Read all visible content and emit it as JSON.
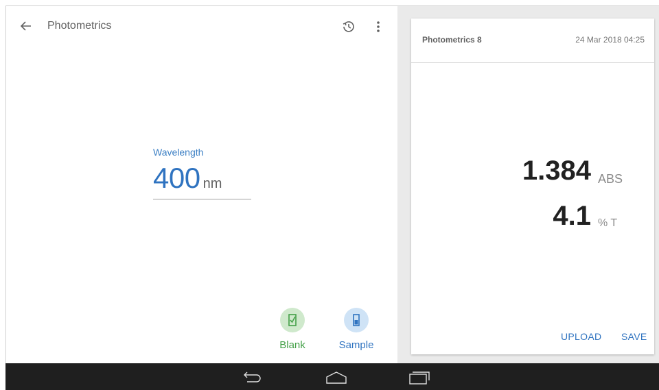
{
  "header": {
    "title": "Photometrics",
    "back_icon": "arrow-left-icon",
    "history_icon": "history-icon",
    "more_icon": "more-vert-icon"
  },
  "wavelength": {
    "label": "Wavelength",
    "value": "400",
    "unit": "nm"
  },
  "actions": {
    "blank": {
      "label": "Blank",
      "icon": "blank-cuvette-icon",
      "color": "#43a047"
    },
    "sample": {
      "label": "Sample",
      "icon": "sample-cuvette-icon",
      "color": "#2f73c0"
    }
  },
  "result_card": {
    "title": "Photometrics 8",
    "date": "24 Mar 2018 04:25",
    "absorbance": {
      "value": "1.384",
      "unit": "ABS"
    },
    "transmittance": {
      "value": "4.1",
      "unit": "% T"
    },
    "upload_label": "UPLOAD",
    "save_label": "SAVE"
  },
  "navbar": {
    "back_icon": "nav-back-icon",
    "home_icon": "nav-home-icon",
    "recents_icon": "nav-recents-icon"
  },
  "colors": {
    "accent": "#2f73c0",
    "blank_green": "#43a047",
    "pane_bg": "#eaeaea",
    "navbar_bg": "#1f1f1f"
  }
}
